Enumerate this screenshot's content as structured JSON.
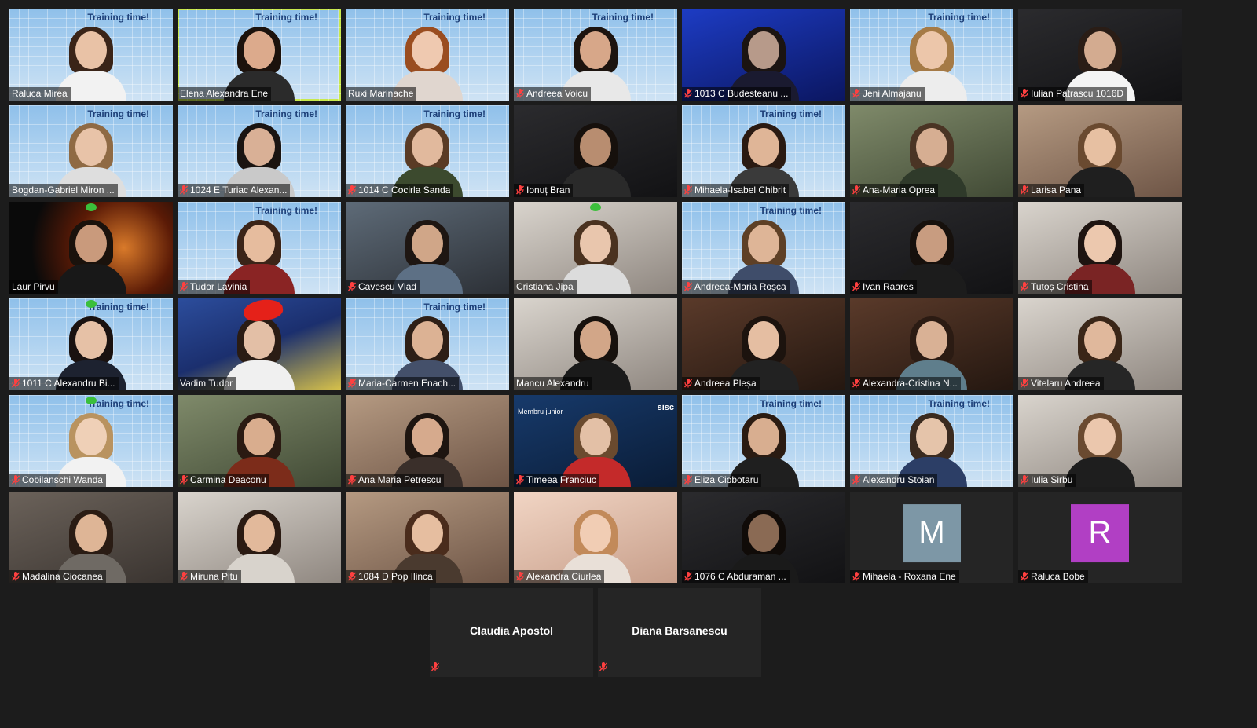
{
  "participants": [
    {
      "name": "Raluca Mirea",
      "muted": false,
      "bg": "bg-training",
      "training": "Training time!",
      "skin": "#e9c2a6",
      "hair": "#3a2418",
      "shirt": "#f2f2f2"
    },
    {
      "name": "Elena Alexandra Ene",
      "muted": false,
      "bg": "bg-training",
      "training": "Training time!",
      "skin": "#dcaa8c",
      "hair": "#1c120c",
      "shirt": "#2b2b2b",
      "active": true
    },
    {
      "name": "Ruxi Marinache",
      "muted": false,
      "bg": "bg-training",
      "training": "Training time!",
      "skin": "#efc9b0",
      "hair": "#9a4d20",
      "shirt": "#e0d6cf"
    },
    {
      "name": "Andreea Voicu",
      "muted": true,
      "bg": "bg-training",
      "training": "Training time!",
      "skin": "#d7a789",
      "hair": "#1d140f",
      "shirt": "#e8e8e8"
    },
    {
      "name": "1013 C Budesteanu ...",
      "muted": true,
      "bg": "bg-blue",
      "skin": "#b79a8a",
      "hair": "#1b1412",
      "shirt": "#1a1a30"
    },
    {
      "name": "Jeni Almajanu",
      "muted": true,
      "bg": "bg-training",
      "training": "Training time!",
      "skin": "#ecc6aa",
      "hair": "#a57a46",
      "shirt": "#ededed"
    },
    {
      "name": "Iulian Patrascu 1016D",
      "muted": true,
      "bg": "bg-dark",
      "skin": "#d3ab90",
      "hair": "#2a1d16",
      "shirt": "#f4f4f4"
    },
    {
      "name": "Bogdan-Gabriel Miron ...",
      "muted": false,
      "bg": "bg-training",
      "training": "Training time!",
      "skin": "#e8c3a8",
      "hair": "#8f6a44",
      "shirt": "#dedede"
    },
    {
      "name": "1024 E Turiac Alexan...",
      "muted": true,
      "bg": "bg-training",
      "training": "Training time!",
      "skin": "#d9b096",
      "hair": "#1a1411",
      "shirt": "#c9c9c9"
    },
    {
      "name": "1014 C Cocirla Sanda",
      "muted": true,
      "bg": "bg-training",
      "training": "Training time!",
      "skin": "#e1b99d",
      "hair": "#5a3b25",
      "shirt": "#3c4a2e"
    },
    {
      "name": "Ionuț Bran",
      "muted": true,
      "bg": "bg-dark",
      "skin": "#b88d70",
      "hair": "#16100c",
      "shirt": "#2a2a2a"
    },
    {
      "name": "Mihaela-Isabel Chibrit",
      "muted": true,
      "bg": "bg-training",
      "training": "Training time!",
      "skin": "#dfb597",
      "hair": "#2a1a12",
      "shirt": "#3a3a3a"
    },
    {
      "name": "Ana-Maria Oprea",
      "muted": true,
      "bg": "bg-green",
      "skin": "#d6ae92",
      "hair": "#4a3424",
      "shirt": "#2f3a2a"
    },
    {
      "name": "Larisa Pana",
      "muted": true,
      "bg": "bg-warm",
      "skin": "#e7c0a2",
      "hair": "#6a4a30",
      "shirt": "#1f1f1f"
    },
    {
      "name": "Laur Pirvu",
      "muted": false,
      "bg": "bg-space",
      "skin": "#c99a7c",
      "hair": "#1a120c",
      "shirt": "#181818",
      "sprout": true
    },
    {
      "name": "Tudor Lavinia",
      "muted": true,
      "bg": "bg-training",
      "training": "Training time!",
      "skin": "#e6bc9e",
      "hair": "#3b2418",
      "shirt": "#8a2424"
    },
    {
      "name": "Cavescu Vlad",
      "muted": true,
      "bg": "bg-map",
      "skin": "#d0a688",
      "hair": "#1e1612",
      "shirt": "#5d7085"
    },
    {
      "name": "Cristiana Jipa",
      "muted": false,
      "bg": "bg-light",
      "skin": "#e9c6ad",
      "hair": "#4a3220",
      "shirt": "#dcdcdc",
      "sprout": true
    },
    {
      "name": "Andreea-Maria Roșca",
      "muted": true,
      "bg": "bg-training",
      "training": "Training time!",
      "skin": "#deb597",
      "hair": "#5e4026",
      "shirt": "#3f4d6a"
    },
    {
      "name": "Ivan Raares",
      "muted": true,
      "bg": "bg-dark",
      "skin": "#c89c80",
      "hair": "#16100c",
      "shirt": "#1c1c1c"
    },
    {
      "name": "Tutoș Cristina",
      "muted": true,
      "bg": "bg-light",
      "skin": "#ecc8ae",
      "hair": "#1e1410",
      "shirt": "#7a2424"
    },
    {
      "name": "1011 C Alexandru Bi...",
      "muted": true,
      "bg": "bg-training",
      "training": "Training time!",
      "skin": "#e6c1a6",
      "hair": "#1a1210",
      "shirt": "#1d2230",
      "sprout": true
    },
    {
      "name": "Vadim Tudor",
      "muted": false,
      "bg": "bg-starry",
      "skin": "#e3bfa6",
      "hair": "#2a1c14",
      "shirt": "#f0f0f0",
      "hat": true
    },
    {
      "name": "Maria-Carmen Enach...",
      "muted": true,
      "bg": "bg-training",
      "training": "Training time!",
      "skin": "#dcb294",
      "hair": "#2e1f16",
      "shirt": "#44506a"
    },
    {
      "name": "Mancu Alexandru",
      "muted": false,
      "bg": "bg-light",
      "skin": "#d2a688",
      "hair": "#17110d",
      "shirt": "#1a1a1a"
    },
    {
      "name": "Andreea Pleșa",
      "muted": true,
      "bg": "bg-purple",
      "skin": "#e5bea2",
      "hair": "#1c130e",
      "shirt": "#222222"
    },
    {
      "name": "Alexandra-Cristina N...",
      "muted": true,
      "bg": "bg-purple",
      "skin": "#d9b195",
      "hair": "#2b1b13",
      "shirt": "#5f7e8c"
    },
    {
      "name": "Vitelaru Andreea",
      "muted": true,
      "bg": "bg-light",
      "skin": "#e0b89c",
      "hair": "#3a2618",
      "shirt": "#262626"
    },
    {
      "name": "Cobilanschi Wanda",
      "muted": true,
      "bg": "bg-training",
      "training": "Training time!",
      "skin": "#efd0b7",
      "hair": "#b99360",
      "shirt": "#f2f2f2",
      "sprout": true
    },
    {
      "name": "Carmina Deaconu",
      "muted": true,
      "bg": "bg-green",
      "skin": "#d9ad8e",
      "hair": "#2a1a12",
      "shirt": "#7c2c1a"
    },
    {
      "name": "Ana Maria Petrescu",
      "muted": true,
      "bg": "bg-warm",
      "skin": "#d6aa8d",
      "hair": "#1e1510",
      "shirt": "#3a2f2a"
    },
    {
      "name": "Timeea Franciuc",
      "muted": true,
      "bg": "bg-member",
      "skin": "#e3c0a6",
      "hair": "#6a4a2e",
      "shirt": "#c42a2a",
      "corner": "Membru junior",
      "logo": "sisc"
    },
    {
      "name": "Eliza Ciobotaru",
      "muted": true,
      "bg": "bg-training",
      "training": "Training time!",
      "skin": "#d8ae90",
      "hair": "#2a1b12",
      "shirt": "#1f1f1f"
    },
    {
      "name": "Alexandru Stoian",
      "muted": true,
      "bg": "bg-training",
      "training": "Training time!",
      "skin": "#e5c4aa",
      "hair": "#3a2a1f",
      "shirt": "#2c3e66"
    },
    {
      "name": "Iulia Sirbu",
      "muted": true,
      "bg": "bg-light",
      "skin": "#ebc7ad",
      "hair": "#6a4a30",
      "shirt": "#1e1e1e"
    },
    {
      "name": "Madalina Ciocanea",
      "muted": true,
      "bg": "bg-room",
      "skin": "#deb596",
      "hair": "#2a1c14",
      "shirt": "#6f6a64"
    },
    {
      "name": "Miruna Pitu",
      "muted": true,
      "bg": "bg-light",
      "skin": "#e2b99b",
      "hair": "#2a1a12",
      "shirt": "#d8d3cc"
    },
    {
      "name": "1084 D Pop Ilinca",
      "muted": true,
      "bg": "bg-warm",
      "skin": "#e6bea0",
      "hair": "#4a2c1c",
      "shirt": "#4a3a2f"
    },
    {
      "name": "Alexandra Ciurlea",
      "muted": true,
      "bg": "bg-peach",
      "skin": "#f1cdb4",
      "hair": "#c28a5a",
      "shirt": "#e9e0d8"
    },
    {
      "name": "1076 C Abduraman ...",
      "muted": true,
      "bg": "bg-dark",
      "skin": "#8a6a54",
      "hair": "#100b08",
      "shirt": "#1a1a1a"
    },
    {
      "name": "Mihaela - Roxana Ene",
      "muted": true,
      "bg": "bg-plain",
      "avatar": "M",
      "avatarColor": "#7d97a6"
    },
    {
      "name": "Raluca Bobe",
      "muted": true,
      "bg": "bg-plain",
      "avatar": "R",
      "avatarColor": "#b13fc4"
    }
  ],
  "audio_only": [
    {
      "name": "Claudia Apostol",
      "muted": true
    },
    {
      "name": "Diana Barsanescu",
      "muted": true
    }
  ]
}
